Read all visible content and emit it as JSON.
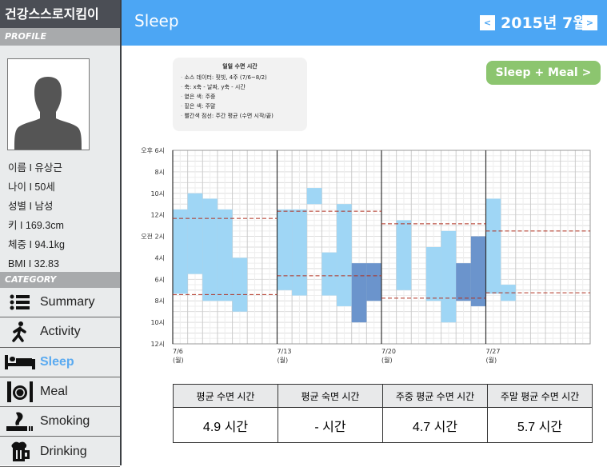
{
  "app_title": "건강스스로지킴이",
  "sidebar": {
    "profile_label": "PROFILE",
    "profile": [
      "이름 I 유상근",
      "나이 I 50세",
      "성별 I 남성",
      "키 I 169.3cm",
      "체중 I 94.1kg",
      "BMI I 32.83"
    ],
    "category_label": "CATEGORY",
    "items": [
      {
        "label": "Summary",
        "icon": "list-icon"
      },
      {
        "label": "Activity",
        "icon": "running-person-icon"
      },
      {
        "label": "Sleep",
        "icon": "bed-icon",
        "active": true
      },
      {
        "label": "Meal",
        "icon": "plate-cutlery-icon"
      },
      {
        "label": "Smoking",
        "icon": "cigarette-icon"
      },
      {
        "label": "Drinking",
        "icon": "beer-mug-icon"
      }
    ]
  },
  "header": {
    "title": "Sleep",
    "month": "2015년 7월",
    "prev": "<",
    "next": ">"
  },
  "sleep_meal_button": "Sleep + Meal >",
  "legend": {
    "title": "일일 수면 시간",
    "items": [
      "소스 데이터: 핏빗, 4주 (7/6~8/2)",
      "축: x축 - 날짜, y축 - 시간",
      "옅은 색: 주중",
      "짙은 색: 주말",
      "빨간색 점선: 주간 평균 (수면 시작/끝)"
    ]
  },
  "colors": {
    "weekday": "#9fd6f5",
    "weekend": "#6b94cc",
    "average_line": "#b03020",
    "header": "#4ca6f4",
    "button": "#8cc56f"
  },
  "chart_data": {
    "type": "bar",
    "x_range": [
      "7/6",
      "8/2"
    ],
    "y_range": [
      "18:00",
      "12:00"
    ],
    "y_ticks": [
      "오후 6시",
      "8시",
      "10시",
      "12시",
      "오전 2시",
      "4시",
      "6시",
      "8시",
      "10시",
      "12시"
    ],
    "x_ticks": [
      {
        "date": "7/6",
        "day": "(월)"
      },
      {
        "date": "7/13",
        "day": "(월)"
      },
      {
        "date": "7/20",
        "day": "(월)"
      },
      {
        "date": "7/27",
        "day": "(월)"
      }
    ],
    "sleep": [
      {
        "date": "7/6",
        "start": "23:30",
        "end": "07:20",
        "type": "weekday"
      },
      {
        "date": "7/7",
        "start": "22:00",
        "end": "05:30",
        "type": "weekday"
      },
      {
        "date": "7/8",
        "start": "22:30",
        "end": "08:00",
        "type": "weekday"
      },
      {
        "date": "7/9",
        "start": "23:30",
        "end": "08:00",
        "type": "weekday"
      },
      {
        "date": "7/10",
        "start": "04:00",
        "end": "09:00",
        "type": "weekday"
      },
      {
        "date": "7/13",
        "start": "23:30",
        "end": "07:00",
        "type": "weekday"
      },
      {
        "date": "7/14",
        "start": "23:30",
        "end": "07:30",
        "type": "weekday"
      },
      {
        "date": "7/15",
        "start": "21:30",
        "end": "23:00",
        "type": "weekday"
      },
      {
        "date": "7/16",
        "start": "03:30",
        "end": "07:30",
        "type": "weekday"
      },
      {
        "date": "7/17",
        "start": "23:00",
        "end": "08:30",
        "type": "weekday"
      },
      {
        "date": "7/18",
        "start": "04:30",
        "end": "10:00",
        "type": "weekend"
      },
      {
        "date": "7/19",
        "start": "04:30",
        "end": "08:00",
        "type": "weekend"
      },
      {
        "date": "7/21",
        "start": "00:30",
        "end": "07:00",
        "type": "weekday"
      },
      {
        "date": "7/23",
        "start": "03:00",
        "end": "08:00",
        "type": "weekday"
      },
      {
        "date": "7/24",
        "start": "01:30",
        "end": "10:00",
        "type": "weekday"
      },
      {
        "date": "7/25",
        "start": "04:30",
        "end": "08:00",
        "type": "weekend"
      },
      {
        "date": "7/26",
        "start": "02:00",
        "end": "08:30",
        "type": "weekend"
      },
      {
        "date": "7/27",
        "start": "22:30",
        "end": "07:20",
        "type": "weekday"
      },
      {
        "date": "7/28",
        "start": "06:30",
        "end": "08:00",
        "type": "weekday"
      }
    ],
    "weekly_average": [
      {
        "week": "7/6",
        "start": "00:20",
        "end": "07:25"
      },
      {
        "week": "7/13",
        "start": "23:40",
        "end": "05:40"
      },
      {
        "week": "7/20",
        "start": "00:50",
        "end": "07:45"
      },
      {
        "week": "7/27",
        "start": "01:30",
        "end": "07:15"
      }
    ]
  },
  "summary": {
    "headers": [
      "평균 수면 시간",
      "평균 숙면 시간",
      "주중 평균 수면 시간",
      "주말 평균 수면 시간"
    ],
    "values": [
      "4.9 시간",
      "- 시간",
      "4.7 시간",
      "5.7 시간"
    ]
  }
}
